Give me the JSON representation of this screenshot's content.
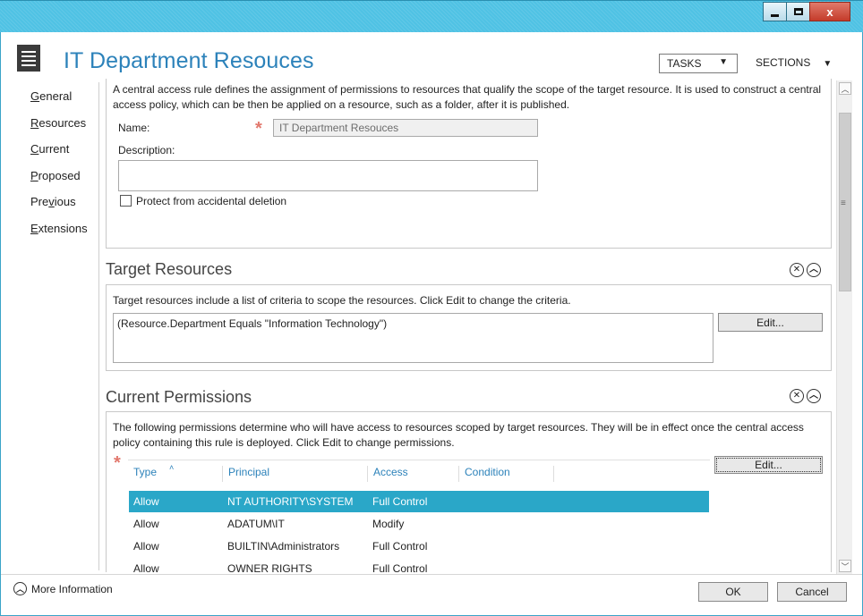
{
  "window": {
    "minimize_icon": "minimize-icon",
    "maximize_icon": "maximize-icon",
    "close_label": "x"
  },
  "header": {
    "title": "IT Department Resouces",
    "tasks_label": "TASKS",
    "sections_label": "SECTIONS"
  },
  "nav": {
    "items": [
      {
        "label": "General"
      },
      {
        "label": "Resources"
      },
      {
        "label": "Current"
      },
      {
        "label": "Proposed"
      },
      {
        "label": "Previous"
      },
      {
        "label": "Extensions"
      }
    ]
  },
  "general": {
    "intro": "A central access rule defines the assignment of permissions to resources that qualify the scope of the target resource. It is used to construct a central access policy, which can be then be applied on a resource, such as a folder, after it is published.",
    "name_label": "Name:",
    "name_value": "IT Department Resouces",
    "description_label": "Description:",
    "description_value": "",
    "protect_label": "Protect from accidental deletion",
    "protect_checked": false
  },
  "target_resources": {
    "title": "Target Resources",
    "intro": "Target resources include a list of criteria to scope the resources. Click Edit to change the criteria.",
    "criteria": "(Resource.Department Equals \"Information Technology\")",
    "edit_label": "Edit..."
  },
  "current_permissions": {
    "title": "Current Permissions",
    "intro": "The following permissions determine who will have access to resources scoped by target resources. They will be in effect once the central access policy containing this rule is deployed. Click Edit to change permissions.",
    "edit_label": "Edit...",
    "columns": [
      "Type",
      "Principal",
      "Access",
      "Condition"
    ],
    "rows": [
      {
        "type": "Allow",
        "principal": "NT AUTHORITY\\SYSTEM",
        "access": "Full Control",
        "condition": "",
        "selected": true
      },
      {
        "type": "Allow",
        "principal": "ADATUM\\IT",
        "access": "Modify",
        "condition": "",
        "selected": false
      },
      {
        "type": "Allow",
        "principal": "BUILTIN\\Administrators",
        "access": "Full Control",
        "condition": "",
        "selected": false
      },
      {
        "type": "Allow",
        "principal": "OWNER RIGHTS",
        "access": "Full Control",
        "condition": "",
        "selected": false
      }
    ]
  },
  "footer": {
    "more_info_label": "More Information",
    "ok_label": "OK",
    "cancel_label": "Cancel"
  },
  "colors": {
    "title_blue": "#2c82ba",
    "selection": "#2aa7c8",
    "titlebar": "#4fc2e4",
    "required": "#e2786d"
  }
}
